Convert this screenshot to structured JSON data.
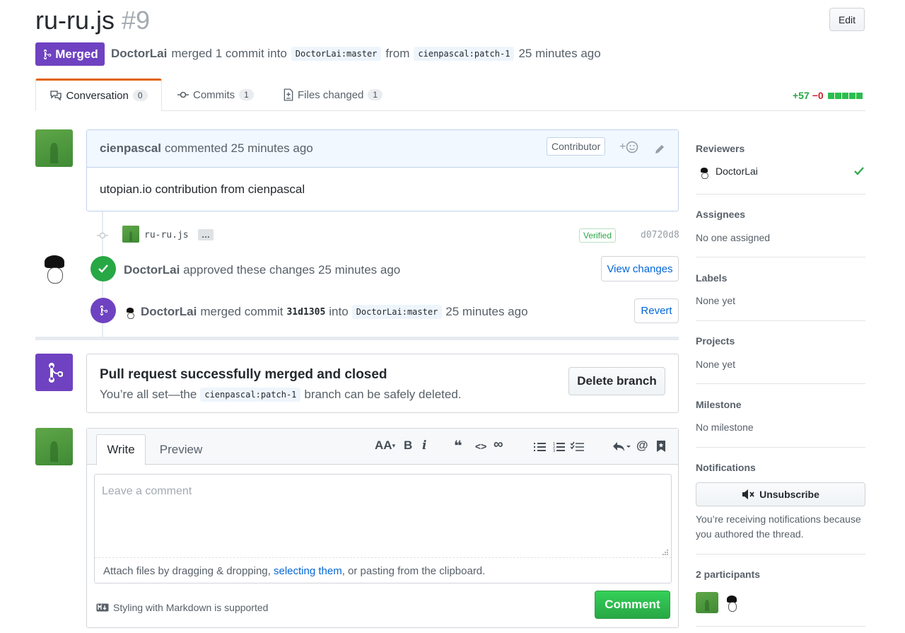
{
  "pr": {
    "title": "ru-ru.js",
    "number": "#9",
    "state_label": "Merged",
    "author": "DoctorLai",
    "merged_text": "merged 1 commit into",
    "base_branch": "DoctorLai:master",
    "from_word": "from",
    "head_branch": "cienpascal:patch-1",
    "time": "25 minutes ago",
    "edit_label": "Edit"
  },
  "tabs": [
    {
      "label": "Conversation",
      "count": "0"
    },
    {
      "label": "Commits",
      "count": "1"
    },
    {
      "label": "Files changed",
      "count": "1"
    }
  ],
  "diffstat": {
    "added": "+57",
    "removed": "−0"
  },
  "comment": {
    "author": "cienpascal",
    "action": "commented 25 minutes ago",
    "badge": "Contributor",
    "reaction": "+",
    "body": "utopian.io contribution from cienpascal"
  },
  "commit": {
    "message": "ru-ru.js",
    "ellipsis": "…",
    "verified": "Verified",
    "sha": "d0720d8"
  },
  "review": {
    "author": "DoctorLai",
    "text": "approved these changes 25 minutes ago",
    "button": "View changes"
  },
  "merge_event": {
    "author": "DoctorLai",
    "text": "merged commit",
    "sha": "31d1305",
    "into": "into",
    "branch": "DoctorLai:master",
    "time": "25 minutes ago",
    "button": "Revert"
  },
  "merged_box": {
    "title": "Pull request successfully merged and closed",
    "desc_pre": "You’re all set—the",
    "branch": "cienpascal:patch-1",
    "desc_post": "branch can be safely deleted.",
    "button": "Delete branch"
  },
  "editor": {
    "tab_write": "Write",
    "tab_preview": "Preview",
    "placeholder": "Leave a comment",
    "attach_pre": "Attach files by dragging & dropping,",
    "attach_link": "selecting them",
    "attach_post": ", or pasting from the clipboard.",
    "markdown_note": "Styling with Markdown is supported",
    "submit": "Comment",
    "toolbar": {
      "header": "AA",
      "bold": "B",
      "italic": "i",
      "quote": "❝",
      "code": "<>",
      "link": "∞",
      "mention": "@"
    }
  },
  "sidebar": {
    "reviewers_heading": "Reviewers",
    "reviewer_name": "DoctorLai",
    "assignees_heading": "Assignees",
    "assignees_value": "No one assigned",
    "labels_heading": "Labels",
    "labels_value": "None yet",
    "projects_heading": "Projects",
    "projects_value": "None yet",
    "milestone_heading": "Milestone",
    "milestone_value": "No milestone",
    "notifications_heading": "Notifications",
    "unsubscribe": "Unsubscribe",
    "notifications_reason": "You’re receiving notifications because you authored the thread.",
    "participants": "2 participants"
  },
  "colors": {
    "merged": "#6f42c1",
    "success": "#28a745",
    "link": "#0366d6",
    "danger": "#cb2431"
  }
}
